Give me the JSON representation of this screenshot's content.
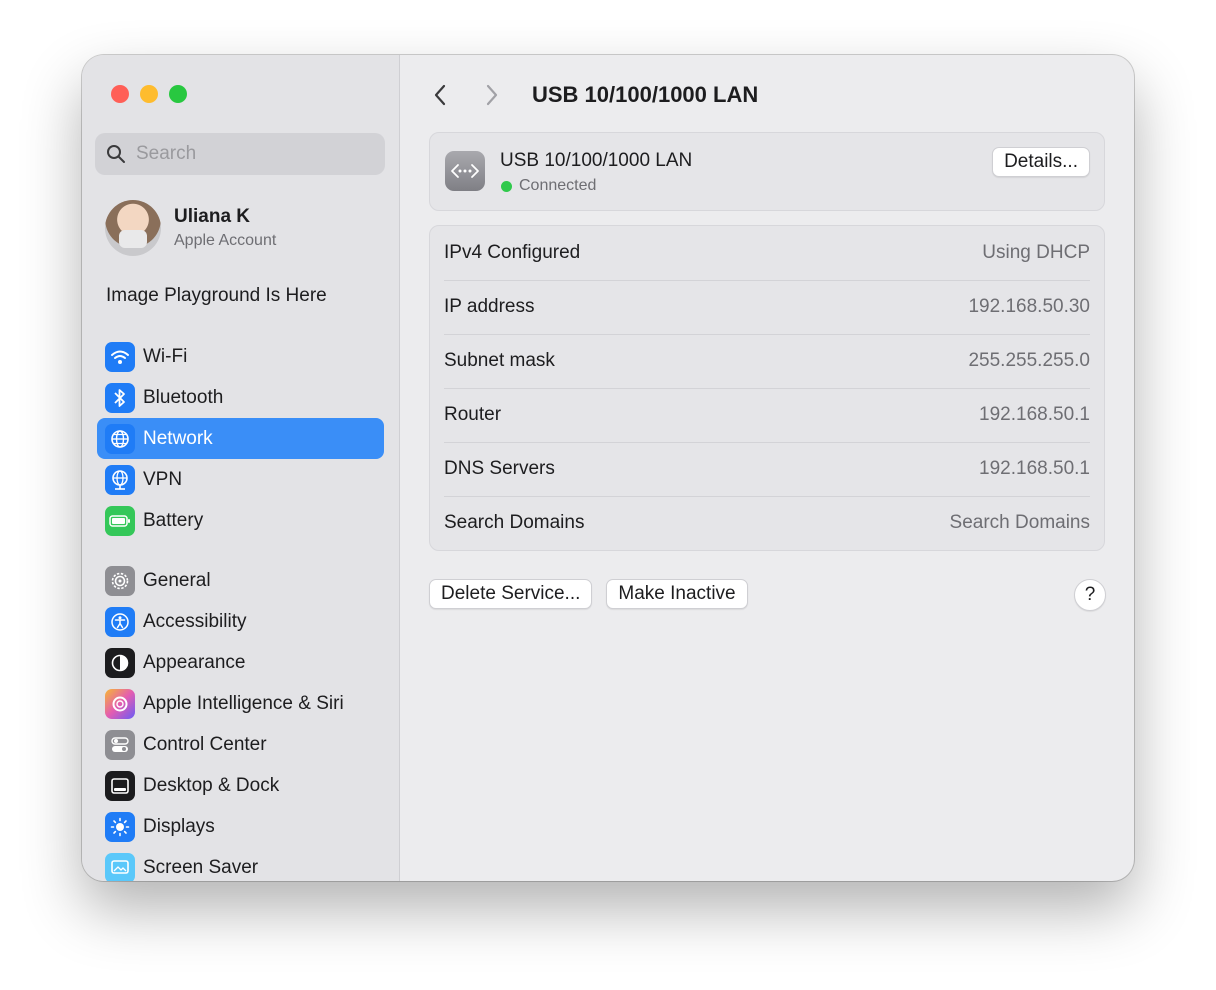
{
  "window": {
    "title": "USB 10/100/1000 LAN"
  },
  "sidebar": {
    "search_placeholder": "Search",
    "account": {
      "name": "Uliana K",
      "subtitle": "Apple Account"
    },
    "promo": "Image Playground Is Here",
    "groups": [
      [
        {
          "label": "Wi-Fi",
          "icon": "wifi-icon",
          "color": "#1f7cf6"
        },
        {
          "label": "Bluetooth",
          "icon": "bluetooth-icon",
          "color": "#1f7cf6"
        },
        {
          "label": "Network",
          "icon": "globe-icon",
          "color": "#1f7cf6",
          "selected": true
        },
        {
          "label": "VPN",
          "icon": "vpn-globe-icon",
          "color": "#1f7cf6"
        },
        {
          "label": "Battery",
          "icon": "battery-icon",
          "color": "#34c759"
        }
      ],
      [
        {
          "label": "General",
          "icon": "gear-icon",
          "color": "#8e8e93"
        },
        {
          "label": "Accessibility",
          "icon": "accessibility-icon",
          "color": "#1f7cf6"
        },
        {
          "label": "Appearance",
          "icon": "appearance-icon",
          "color": "#1c1c1e"
        },
        {
          "label": "Apple Intelligence & Siri",
          "icon": "siri-icon",
          "color": "#e35db1"
        },
        {
          "label": "Control Center",
          "icon": "toggles-icon",
          "color": "#8e8e93"
        },
        {
          "label": "Desktop & Dock",
          "icon": "dock-icon",
          "color": "#1c1c1e"
        },
        {
          "label": "Displays",
          "icon": "sun-icon",
          "color": "#1f7cf6"
        },
        {
          "label": "Screen Saver",
          "icon": "screen-saver-icon",
          "color": "#5ac8fa"
        }
      ]
    ]
  },
  "service": {
    "name": "USB 10/100/1000 LAN",
    "status": "Connected",
    "status_color": "#30c94c",
    "details_label": "Details..."
  },
  "info_rows": [
    {
      "key": "IPv4 Configured",
      "value": "Using DHCP"
    },
    {
      "key": "IP address",
      "value": "192.168.50.30"
    },
    {
      "key": "Subnet mask",
      "value": "255.255.255.0"
    },
    {
      "key": "Router",
      "value": "192.168.50.1"
    },
    {
      "key": "DNS Servers",
      "value": "192.168.50.1"
    },
    {
      "key": "Search Domains",
      "value": "Search Domains"
    }
  ],
  "actions": {
    "delete_label": "Delete Service...",
    "inactive_label": "Make Inactive",
    "help_label": "?"
  }
}
